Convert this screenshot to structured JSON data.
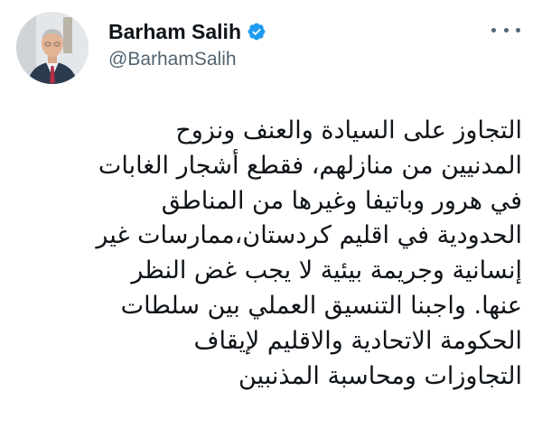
{
  "author": {
    "display_name": "Barham Salih",
    "handle": "@BarhamSalih",
    "verified": true,
    "verified_color": "#1d9bf0"
  },
  "tweet": {
    "lines": [
      "التجاوز على السيادة والعنف ونزوح",
      "المدنيين من منازلهم، فقطع أشجار الغابات",
      "في هرور وباتيفا وغيرها من المناطق",
      "الحدودية في اقليم كردستان،ممارسات غير",
      "إنسانية وجريمة بيئية لا يجب غض النظر",
      "عنها. واجبنا التنسيق العملي بين سلطات",
      "الحكومة الاتحادية والاقليم لإيقاف",
      "التجاوزات ومحاسبة المذنبين"
    ]
  },
  "icons": {
    "avatar": "profile-photo",
    "verified": "verified-badge-icon",
    "more": "more-options-icon"
  }
}
